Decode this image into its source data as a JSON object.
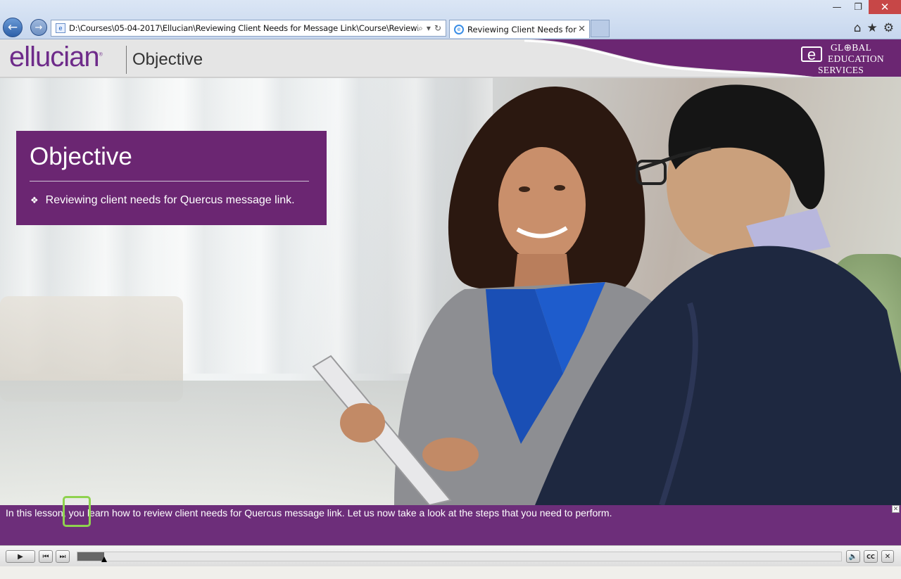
{
  "browser": {
    "url": "D:\\Courses\\05-04-2017\\Ellucian\\Reviewing Client Needs for Message Link\\Course\\Reviewin",
    "tab_title": "Reviewing Client Needs for ...",
    "window_controls": [
      "minimize",
      "restore",
      "close"
    ],
    "toolbar_icons": [
      "home-icon",
      "star-icon",
      "gear-icon"
    ]
  },
  "header": {
    "logo": "ellucian",
    "title": "Objective",
    "brand_lines": [
      "GL",
      "BAL",
      "EDUCATION",
      "SERVICES"
    ],
    "brand_mark": "e"
  },
  "slide": {
    "heading": "Objective",
    "bullet": "Reviewing client needs for Quercus message link."
  },
  "caption": {
    "text": "In this lesson, you learn how to review client needs for Quercus message link. Let us now take a look at the steps that you need to perform."
  },
  "player": {
    "progress": 0.035,
    "buttons": [
      "play",
      "previous",
      "next",
      "volume",
      "cc",
      "close"
    ]
  },
  "colors": {
    "brand_purple": "#6b2672",
    "caption_purple": "#6d2e7a",
    "highlight_green": "#8fd24f"
  }
}
